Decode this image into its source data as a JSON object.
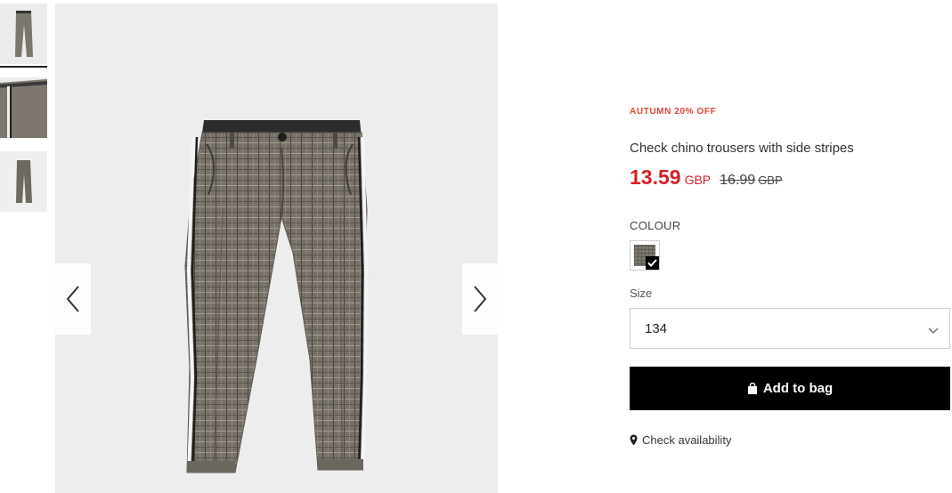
{
  "colors": {
    "promo": "#e5443b",
    "price_now": "#d61f26",
    "button_bg": "#000000",
    "button_text": "#ffffff"
  },
  "gallery": {
    "thumbnails": [
      {
        "alt": "front view thumbnail",
        "selected": true
      },
      {
        "alt": "side detail thumbnail",
        "selected": false
      },
      {
        "alt": "back view thumbnail",
        "selected": false
      }
    ],
    "prev_icon": "chevron-left-icon",
    "next_icon": "chevron-right-icon"
  },
  "product": {
    "promo": "AUTUMN 20% OFF",
    "title": "Check chino trousers with side stripes",
    "price": {
      "current": "13.59",
      "current_currency": "GBP",
      "original": "16.99",
      "original_currency": "GBP"
    },
    "colour_label": "COLOUR",
    "colour_icon": "check-icon",
    "size_label": "Size",
    "size_value": "134",
    "size_icon": "chevron-down-icon",
    "add_to_bag": "Add to bag",
    "add_icon": "shopping-bag-icon",
    "availability": "Check availability",
    "availability_icon": "map-pin-icon"
  }
}
